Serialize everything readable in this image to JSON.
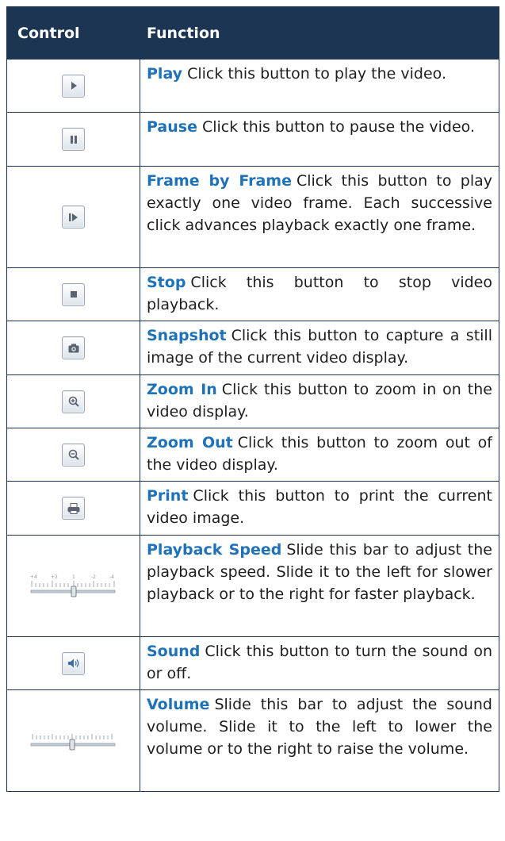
{
  "header": {
    "control": "Control",
    "function": "Function"
  },
  "rows": [
    {
      "icon": "play-icon",
      "name": "Play",
      "text": "Click this button to play the video."
    },
    {
      "icon": "pause-icon",
      "name": "Pause",
      "text": "Click this button to pause the video."
    },
    {
      "icon": "frame-by-frame-icon",
      "name": "Frame by Frame",
      "text": "Click this button to play exactly one video frame. Each successive click advances playback exactly one frame."
    },
    {
      "icon": "stop-icon",
      "name": "Stop",
      "text": "Click this button to stop video playback."
    },
    {
      "icon": "camera-icon",
      "name": "Snapshot",
      "text": "Click this button to capture a still image of the current video display."
    },
    {
      "icon": "zoom-in-icon",
      "name": "Zoom In",
      "text": "Click this button to zoom in on the video display."
    },
    {
      "icon": "zoom-out-icon",
      "name": "Zoom Out",
      "text": "Click this button to zoom out of the video display."
    },
    {
      "icon": "printer-icon",
      "name": "Print",
      "text": "Click this button to print the current video image."
    },
    {
      "icon": "playback-speed-slider-icon",
      "name": "Playback Speed",
      "text": "Slide this bar to adjust the playback speed. Slide it to the left for slower playback or to the right for faster playback."
    },
    {
      "icon": "speaker-icon",
      "name": "Sound",
      "text": "Click this button to turn the sound on or off."
    },
    {
      "icon": "volume-slider-icon",
      "name": "Volume",
      "text": "Slide this bar to adjust the sound volume. Slide it to the left to lower the volume or to the right to raise the volume."
    }
  ],
  "colors": {
    "header_bg": "#1b3552",
    "name_text": "#1f72b8"
  }
}
